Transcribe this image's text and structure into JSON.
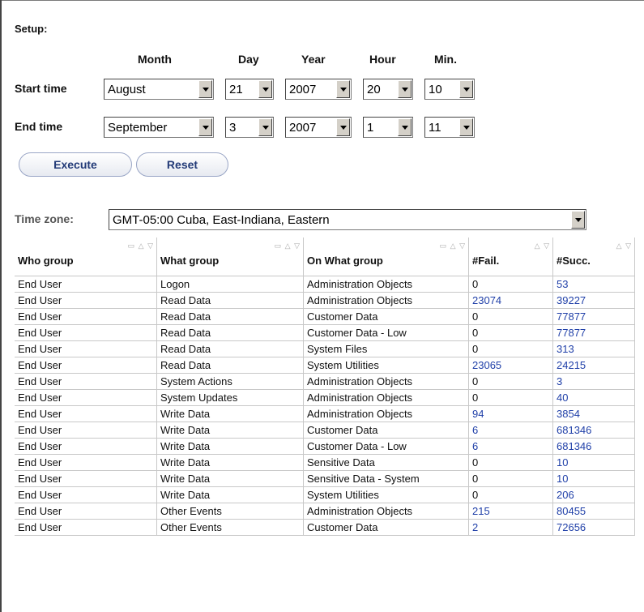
{
  "setup": {
    "title": "Setup:",
    "headers": {
      "month": "Month",
      "day": "Day",
      "year": "Year",
      "hour": "Hour",
      "min": "Min."
    },
    "start": {
      "label": "Start time",
      "month": "August",
      "day": "21",
      "year": "2007",
      "hour": "20",
      "min": "10"
    },
    "end": {
      "label": "End time",
      "month": "September",
      "day": "3",
      "year": "2007",
      "hour": "1",
      "min": "11"
    },
    "execute_label": "Execute",
    "reset_label": "Reset"
  },
  "timezone": {
    "label": "Time zone:",
    "value": "GMT-05:00 Cuba, East-Indiana, Eastern"
  },
  "table": {
    "columns": [
      {
        "label": "Who group",
        "sort_icons": "▭ △ ▽"
      },
      {
        "label": "What group",
        "sort_icons": "▭ △ ▽"
      },
      {
        "label": "On What group",
        "sort_icons": "▭ △ ▽"
      },
      {
        "label": "#Fail.",
        "sort_icons": "△ ▽"
      },
      {
        "label": "#Succ.",
        "sort_icons": "△ ▽"
      }
    ],
    "rows": [
      [
        "End User",
        "Logon",
        "Administration Objects",
        "0",
        "53"
      ],
      [
        "End User",
        "Read Data",
        "Administration Objects",
        "23074",
        "39227"
      ],
      [
        "End User",
        "Read Data",
        "Customer Data",
        "0",
        "77877"
      ],
      [
        "End User",
        "Read Data",
        "Customer Data - Low",
        "0",
        "77877"
      ],
      [
        "End User",
        "Read Data",
        "System Files",
        "0",
        "313"
      ],
      [
        "End User",
        "Read Data",
        "System Utilities",
        "23065",
        "24215"
      ],
      [
        "End User",
        "System Actions",
        "Administration Objects",
        "0",
        "3"
      ],
      [
        "End User",
        "System Updates",
        "Administration Objects",
        "0",
        "40"
      ],
      [
        "End User",
        "Write Data",
        "Administration Objects",
        "94",
        "3854"
      ],
      [
        "End User",
        "Write Data",
        "Customer Data",
        "6",
        "681346"
      ],
      [
        "End User",
        "Write Data",
        "Customer Data - Low",
        "6",
        "681346"
      ],
      [
        "End User",
        "Write Data",
        "Sensitive Data",
        "0",
        "10"
      ],
      [
        "End User",
        "Write Data",
        "Sensitive Data - System",
        "0",
        "10"
      ],
      [
        "End User",
        "Write Data",
        "System Utilities",
        "0",
        "206"
      ],
      [
        "End User",
        "Other Events",
        "Administration Objects",
        "215",
        "80455"
      ],
      [
        "End User",
        "Other Events",
        "Customer Data",
        "2",
        "72656"
      ]
    ]
  },
  "colors": {
    "link": "#1f3fa8",
    "button_text": "#223a77",
    "border": "#c8c8c8"
  }
}
